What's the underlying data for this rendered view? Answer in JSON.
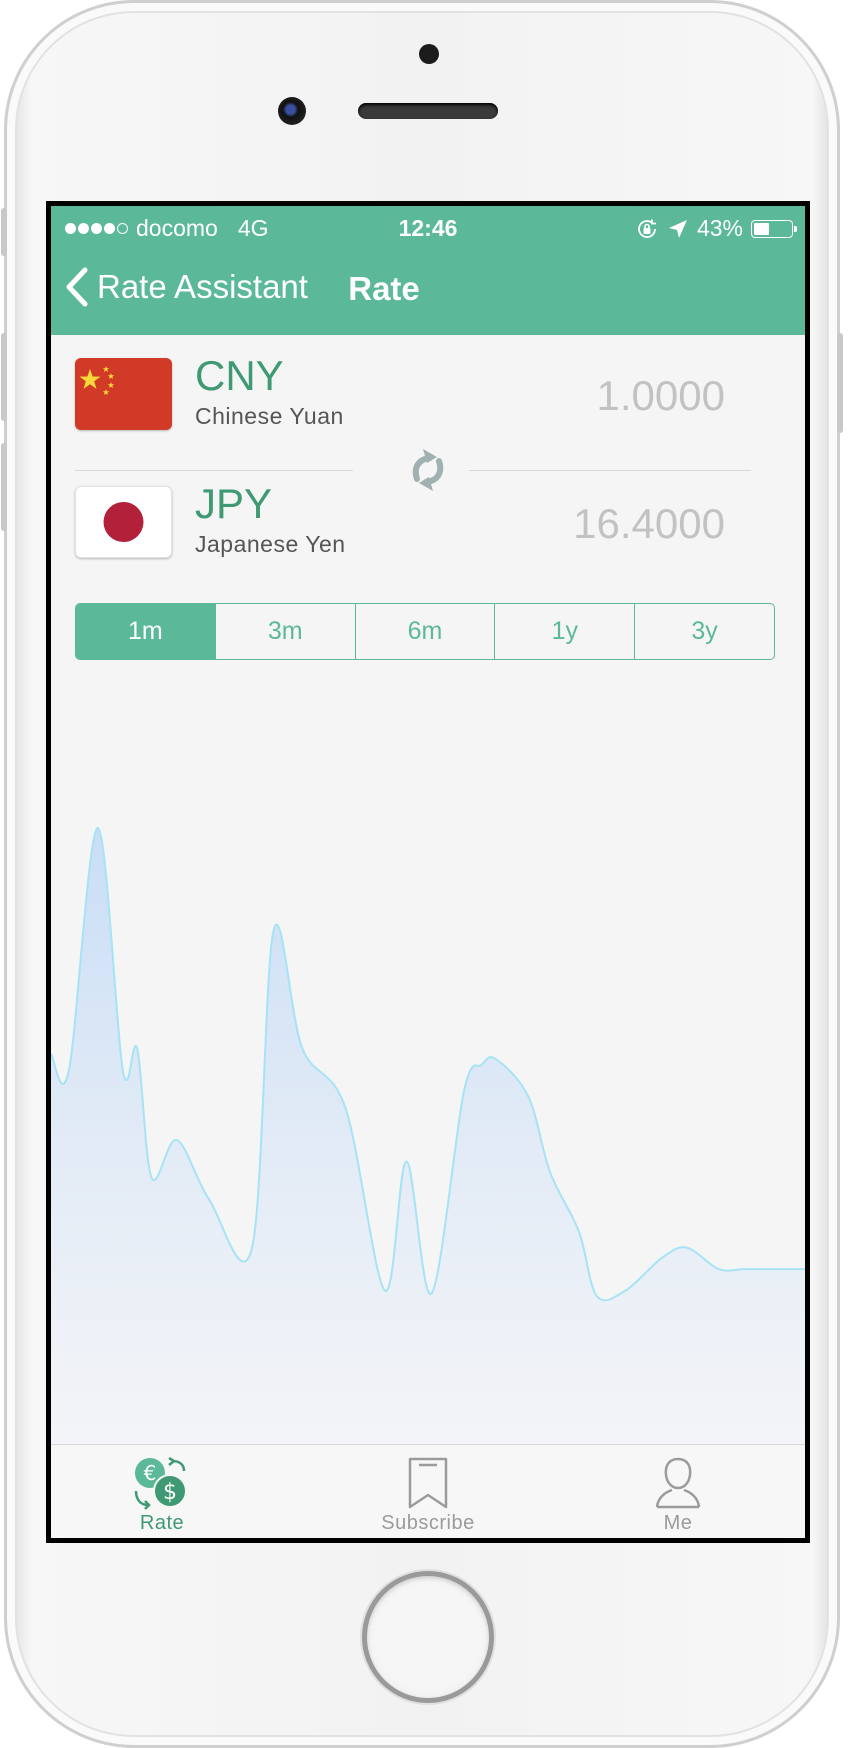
{
  "status_bar": {
    "carrier": "docomo",
    "network": "4G",
    "time": "12:46",
    "battery_percent": "43%",
    "battery_level": 0.43,
    "signal_bars_filled": 4,
    "signal_bars_total": 5,
    "icons": [
      "rotation-lock-icon",
      "location-arrow-icon",
      "battery-icon"
    ]
  },
  "nav": {
    "back_label": "Rate Assistant",
    "title": "Rate"
  },
  "currencies": [
    {
      "code": "CNY",
      "name": "Chinese Yuan",
      "amount": "1.0000",
      "flag": "china-flag"
    },
    {
      "code": "JPY",
      "name": "Japanese Yen",
      "amount": "16.4000",
      "flag": "japan-flag"
    }
  ],
  "swap_icon": "refresh-swap-icon",
  "period_tabs": [
    {
      "label": "1m",
      "active": true
    },
    {
      "label": "3m",
      "active": false
    },
    {
      "label": "6m",
      "active": false
    },
    {
      "label": "1y",
      "active": false
    },
    {
      "label": "3y",
      "active": false
    }
  ],
  "chart_data": {
    "type": "area",
    "title": "",
    "xlabel": "",
    "ylabel": "",
    "grid": false,
    "legend": "none",
    "colors": {
      "line": "#a6e3f5",
      "fill_top": "#c6dcf6",
      "fill_bottom": "#f3f4f8"
    },
    "x": [
      0,
      0.5,
      1.3,
      2,
      2.4,
      2.8,
      3.5,
      4.4,
      5.6,
      6.2,
      7,
      8.2,
      9.3,
      9.9,
      10.6,
      11.5,
      12,
      12.4,
      13.3,
      13.9,
      14.7,
      15.2,
      16,
      17,
      17.7,
      18.6,
      19.3,
      20,
      20.4,
      21
    ],
    "y": [
      0.45,
      0.42,
      0.87,
      0.42,
      0.46,
      0.22,
      0.29,
      0.18,
      0.09,
      0.68,
      0.46,
      0.35,
      0.01,
      0.25,
      0.005,
      0.38,
      0.43,
      0.44,
      0.37,
      0.23,
      0.12,
      0.0,
      0.01,
      0.07,
      0.09,
      0.05,
      0.05,
      0.05,
      0.05,
      0.05
    ]
  },
  "tabbar": [
    {
      "label": "Rate",
      "icon": "currency-exchange-icon",
      "active": true
    },
    {
      "label": "Subscribe",
      "icon": "bookmark-icon",
      "active": false
    },
    {
      "label": "Me",
      "icon": "person-icon",
      "active": false
    }
  ],
  "theme": {
    "accent": "#5bb999",
    "accent_dark": "#3f9a73",
    "muted": "#9b9b9b"
  }
}
